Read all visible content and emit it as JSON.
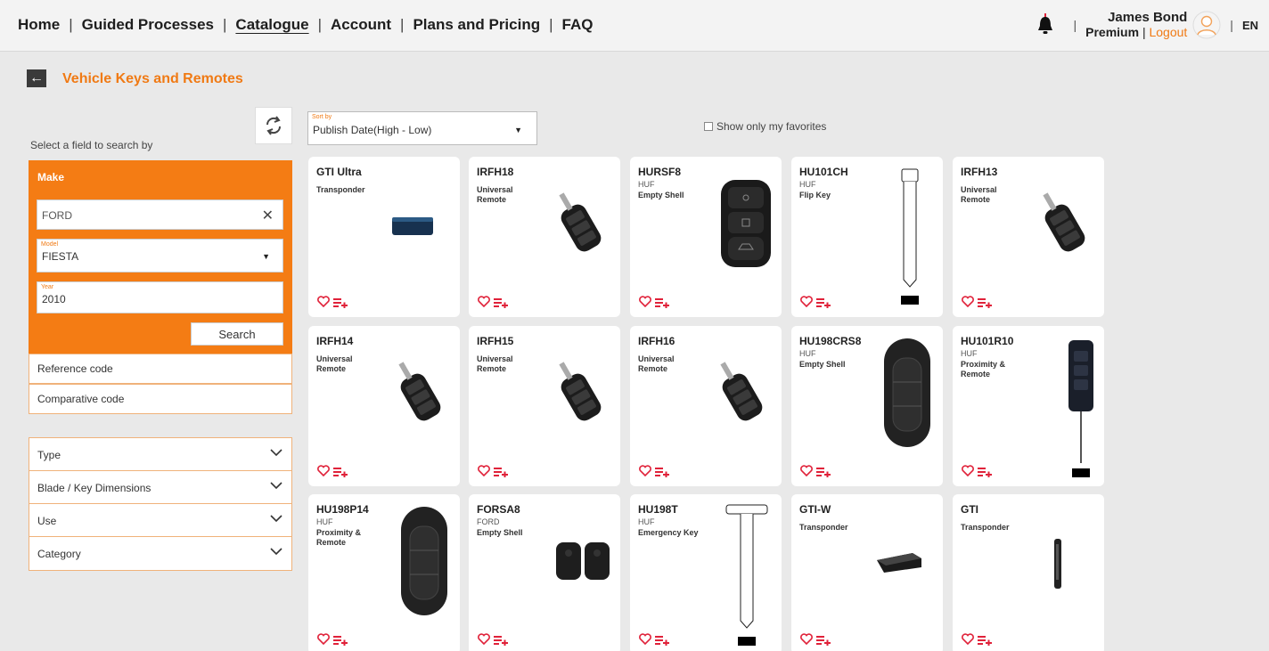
{
  "nav": {
    "items": [
      "Home",
      "Guided Processes",
      "Catalogue",
      "Account",
      "Plans and Pricing",
      "FAQ"
    ],
    "active_index": 2,
    "separator": "|"
  },
  "user": {
    "name": "James Bond",
    "plan": "Premium",
    "divider": "|",
    "logout": "Logout",
    "language": "EN",
    "separator": "|"
  },
  "page": {
    "title": "Vehicle Keys and Remotes",
    "back_icon": "arrow-left-icon"
  },
  "search": {
    "hint": "Select a field to search by",
    "make_title": "Make",
    "make_value": "FORD",
    "model_label": "Model",
    "model_value": "FIESTA",
    "year_label": "Year",
    "year_value": "2010",
    "search_button": "Search",
    "reference_code": "Reference code",
    "comparative_code": "Comparative code"
  },
  "filters": [
    "Type",
    "Blade / Key Dimensions",
    "Use",
    "Category"
  ],
  "sort": {
    "label": "Sort by",
    "value": "Publish Date(High - Low)"
  },
  "favorites_label": "Show only my favorites",
  "colors": {
    "accent": "#f47c14",
    "heart": "#e0223a",
    "background": "#e9e9e9"
  },
  "products": [
    {
      "code": "GTI Ultra",
      "brand": "",
      "type": "Transponder",
      "image": "transponder"
    },
    {
      "code": "IRFH18",
      "brand": "",
      "type": "Universal Remote",
      "image": "flip-remote"
    },
    {
      "code": "HURSF8",
      "brand": "HUF",
      "type": "Empty Shell",
      "image": "shell-3btn"
    },
    {
      "code": "HU101CH",
      "brand": "HUF",
      "type": "Flip Key",
      "image": "blade"
    },
    {
      "code": "IRFH13",
      "brand": "",
      "type": "Universal Remote",
      "image": "flip-remote"
    },
    {
      "code": "IRFH14",
      "brand": "",
      "type": "Universal Remote",
      "image": "flip-remote"
    },
    {
      "code": "IRFH15",
      "brand": "",
      "type": "Universal Remote",
      "image": "flip-remote"
    },
    {
      "code": "IRFH16",
      "brand": "",
      "type": "Universal Remote",
      "image": "flip-remote"
    },
    {
      "code": "HU198CRS8",
      "brand": "HUF",
      "type": "Empty Shell",
      "image": "smart-key"
    },
    {
      "code": "HU101R10",
      "brand": "HUF",
      "type": "Proximity & Remote",
      "image": "remote-blade"
    },
    {
      "code": "HU198P14",
      "brand": "HUF",
      "type": "Proximity & Remote",
      "image": "smart-key"
    },
    {
      "code": "FORSA8",
      "brand": "FORD",
      "type": "Empty Shell",
      "image": "two-shells"
    },
    {
      "code": "HU198T",
      "brand": "HUF",
      "type": "Emergency Key",
      "image": "t-blade"
    },
    {
      "code": "GTI-W",
      "brand": "",
      "type": "Transponder",
      "image": "transponder-wedge"
    },
    {
      "code": "GTI",
      "brand": "",
      "type": "Transponder",
      "image": "glass-transponder"
    }
  ]
}
